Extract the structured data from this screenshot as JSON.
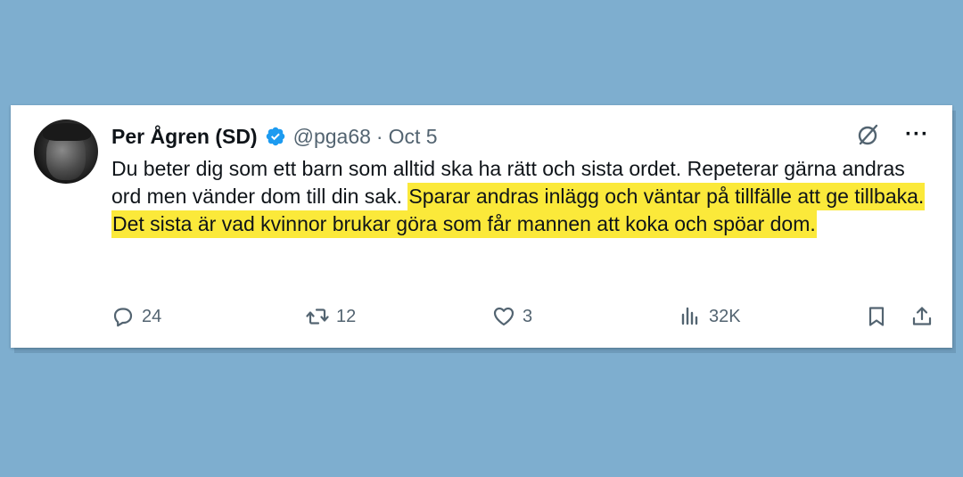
{
  "colors": {
    "background": "#7eaecf",
    "card": "#ffffff",
    "highlight": "#fbe93a",
    "verified": "#1d9bf0",
    "text_primary": "#0f1419",
    "text_secondary": "#536471"
  },
  "tweet": {
    "author_name": "Per Ågren (SD)",
    "handle": "@pga68",
    "separator": "·",
    "date": "Oct 5",
    "text_plain": "Du beter dig som ett barn som alltid ska ha rätt och sista ordet. Repeterar gärna andras ord men vänder dom till din sak. ",
    "text_highlighted": "Sparar andras inlägg och väntar på tillfälle att ge tillbaka. Det sista är vad kvinnor brukar göra som får mannen att koka och spöar dom.",
    "more_label": "···"
  },
  "actions": {
    "replies": "24",
    "reposts": "12",
    "likes": "3",
    "views": "32K"
  },
  "icons": {
    "avatar": "profile-photo",
    "verified": "verified-badge-icon",
    "grok": "grok-icon",
    "more": "more-icon",
    "reply": "reply-icon",
    "repost": "repost-icon",
    "like": "heart-icon",
    "views": "views-icon",
    "bookmark": "bookmark-icon",
    "share": "share-icon"
  }
}
